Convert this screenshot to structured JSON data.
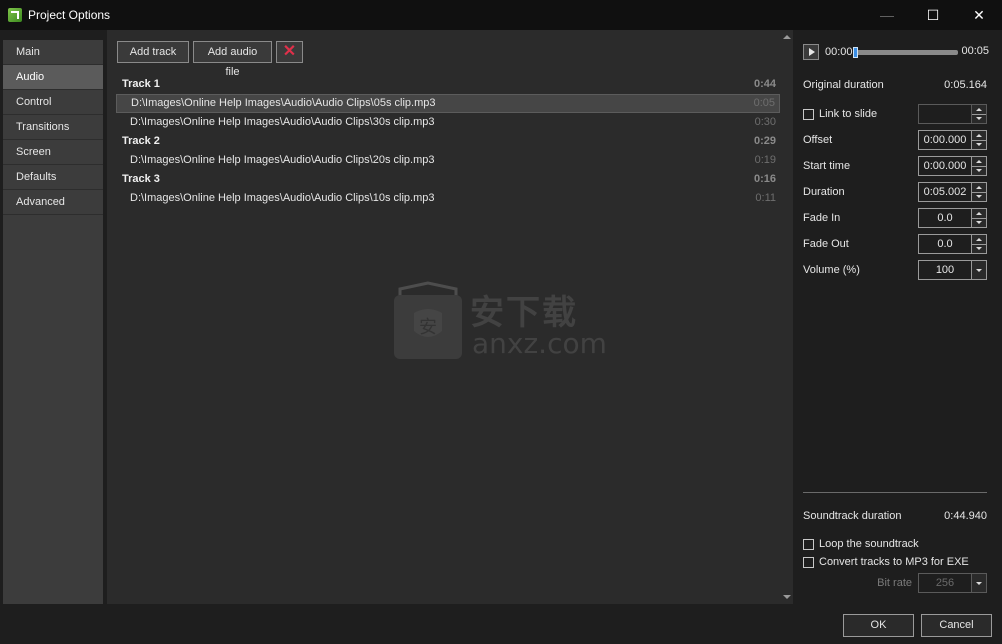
{
  "window": {
    "title": "Project Options",
    "controls": {
      "minimize": "—",
      "maximize": "☐",
      "close": "✕"
    }
  },
  "sidebar": {
    "items": [
      {
        "label": "Main",
        "active": false
      },
      {
        "label": "Audio",
        "active": true
      },
      {
        "label": "Control",
        "active": false
      },
      {
        "label": "Transitions",
        "active": false
      },
      {
        "label": "Screen",
        "active": false
      },
      {
        "label": "Defaults",
        "active": false
      },
      {
        "label": "Advanced",
        "active": false
      }
    ]
  },
  "toolbar": {
    "add_track_label": "Add track",
    "add_audio_file_label": "Add audio file",
    "delete_icon": "✕"
  },
  "tracks": [
    {
      "title": "Track 1",
      "duration": "0:44",
      "clips": [
        {
          "path": "D:\\Images\\Online Help Images\\Audio\\Audio Clips\\05s clip.mp3",
          "duration": "0:05",
          "selected": true
        },
        {
          "path": "D:\\Images\\Online Help Images\\Audio\\Audio Clips\\30s clip.mp3",
          "duration": "0:30",
          "selected": false
        }
      ]
    },
    {
      "title": "Track 2",
      "duration": "0:29",
      "clips": [
        {
          "path": "D:\\Images\\Online Help Images\\Audio\\Audio Clips\\20s clip.mp3",
          "duration": "0:19",
          "selected": false
        }
      ]
    },
    {
      "title": "Track 3",
      "duration": "0:16",
      "clips": [
        {
          "path": "D:\\Images\\Online Help Images\\Audio\\Audio Clips\\10s clip.mp3",
          "duration": "0:11",
          "selected": false
        }
      ]
    }
  ],
  "watermark": {
    "chinese": "安下载",
    "url": "anxz.com"
  },
  "player": {
    "time_start": "00:00",
    "time_end": "00:05",
    "position": 0.0
  },
  "properties": {
    "original_duration_label": "Original duration",
    "original_duration_value": "0:05.164",
    "link_to_slide_label": "Link to slide",
    "link_to_slide_value": "",
    "offset_label": "Offset",
    "offset_value": "0:00.000",
    "start_time_label": "Start time",
    "start_time_value": "0:00.000",
    "duration_label": "Duration",
    "duration_value": "0:05.002",
    "fade_in_label": "Fade In",
    "fade_in_value": "0.0",
    "fade_out_label": "Fade Out",
    "fade_out_value": "0.0",
    "volume_label": "Volume (%)",
    "volume_value": "100"
  },
  "soundtrack": {
    "duration_label": "Soundtrack duration",
    "duration_value": "0:44.940",
    "loop_label": "Loop the soundtrack",
    "convert_label": "Convert tracks to MP3 for EXE",
    "bitrate_label": "Bit rate",
    "bitrate_value": "256"
  },
  "footer": {
    "ok_label": "OK",
    "cancel_label": "Cancel"
  },
  "colors": {
    "background": "#1e1e1e",
    "panel": "#2b2b2b",
    "sidebar": "#3c3c3c",
    "sidebar_active": "#5b5b5b",
    "delete_accent": "#e0304a",
    "seek_thumb": "#3a8ee6"
  }
}
